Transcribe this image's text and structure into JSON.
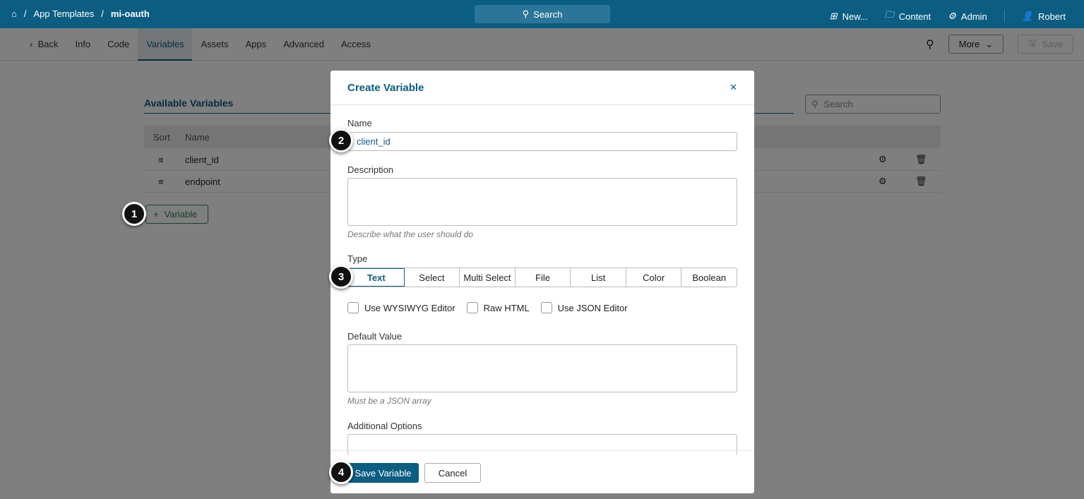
{
  "topbar": {
    "breadcrumb": [
      "App Templates",
      "mi-oauth"
    ],
    "search": "Search",
    "new": "New...",
    "content": "Content",
    "admin": "Admin",
    "user": "Robert"
  },
  "subnav": {
    "back": "Back",
    "tabs": [
      "Info",
      "Code",
      "Variables",
      "Assets",
      "Apps",
      "Advanced",
      "Access"
    ],
    "active": "Variables",
    "more": "More",
    "save": "Save"
  },
  "variables": {
    "title": "Available Variables",
    "search_placeholder": "Search",
    "headers": [
      "Sort",
      "Name"
    ],
    "rows": [
      "client_id",
      "endpoint"
    ],
    "add": "Variable"
  },
  "modal": {
    "title": "Create Variable",
    "name_label": "Name",
    "name_value": "client_id",
    "desc_label": "Description",
    "desc_help": "Describe what the user should do",
    "type_label": "Type",
    "types": [
      "Text",
      "Select",
      "Multi Select",
      "File",
      "List",
      "Color",
      "Boolean"
    ],
    "selected_type": "Text",
    "checks": [
      "Use WYSIWYG Editor",
      "Raw HTML",
      "Use JSON Editor"
    ],
    "default_label": "Default Value",
    "default_help": "Must be a JSON array",
    "additional_label": "Additional Options",
    "save": "Save Variable",
    "cancel": "Cancel"
  },
  "steps": [
    "1",
    "2",
    "3",
    "4"
  ]
}
